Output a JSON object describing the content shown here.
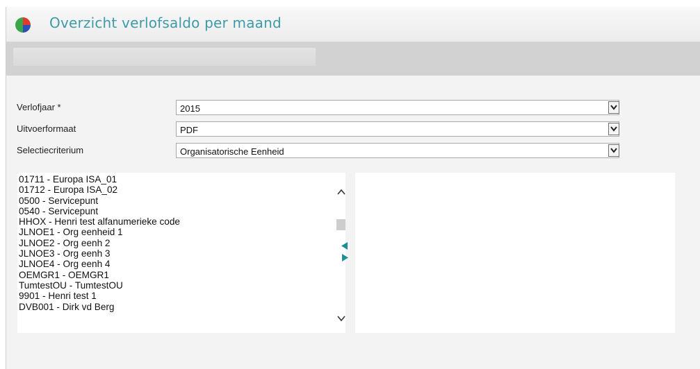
{
  "header": {
    "title": "Overzicht verlofsaldo per maand",
    "logo_icon": "pie-chart-icon"
  },
  "form": {
    "rows": [
      {
        "label": "Verlofjaar *",
        "value": "2015"
      },
      {
        "label": "Uitvoerformaat",
        "value": "PDF"
      },
      {
        "label": "Selectiecriterium",
        "value": "Organisatorische Eenheid"
      }
    ]
  },
  "available_list": {
    "items": [
      "01711 - Europa ISA_01",
      "01712 - Europa ISA_02",
      "0500 - Servicepunt",
      "0540 - Servicepunt",
      "HHOX - Henri test alfanumerieke code",
      "JLNOE1 - Org eenheid 1",
      "JLNOE2 - Org eenh 2",
      "JLNOE3 - Org eenh 3",
      "JLNOE4 - Org eenh 4",
      "OEMGR1 - OEMGR1",
      "TumtestOU - TumtestOU",
      "9901 - Henri test 1",
      "DVB001 - Dirk vd Berg"
    ]
  },
  "colors": {
    "title": "#3d9aa6",
    "arrow": "#1f8f96"
  }
}
